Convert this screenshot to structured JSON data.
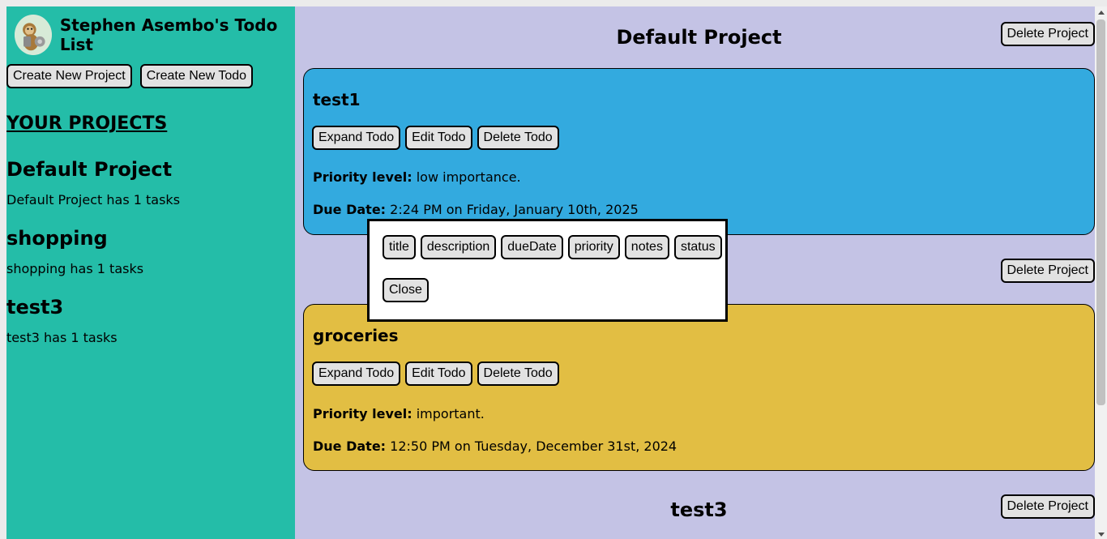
{
  "header": {
    "title": "Stephen Asembo's Todo List",
    "avatar_icon": "monkey-avatar-icon"
  },
  "sidebar": {
    "create_project_label": "Create New Project",
    "create_todo_label": "Create New Todo",
    "projects_heading": "YOUR PROJECTS",
    "projects": [
      {
        "name": "Default Project",
        "summary": "Default Project has 1 tasks"
      },
      {
        "name": "shopping",
        "summary": "shopping has 1 tasks"
      },
      {
        "name": "test3",
        "summary": "test3 has 1 tasks"
      }
    ]
  },
  "main": {
    "delete_project_label": "Delete Project",
    "todo_buttons": {
      "expand": "Expand Todo",
      "edit": "Edit Todo",
      "delete": "Delete Todo"
    },
    "priority_label": "Priority level:",
    "due_label": "Due Date:",
    "sections": [
      {
        "title": "Default Project",
        "todo": {
          "title": "test1",
          "priority": "low importance.",
          "due": "2:24 PM on Friday, January 10th, 2025",
          "color": "#33aadf"
        }
      },
      {
        "title": "",
        "todo": {
          "title": "groceries",
          "priority": "important.",
          "due": "12:50 PM on Tuesday, December 31st, 2024",
          "color": "#e2be43"
        }
      },
      {
        "title": "test3"
      }
    ]
  },
  "modal": {
    "fields": [
      "title",
      "description",
      "dueDate",
      "priority",
      "notes",
      "status"
    ],
    "close_label": "Close"
  },
  "colors": {
    "sidebar_bg": "#24bda8",
    "main_bg": "#c4c3e5",
    "button_bg": "#e2e2e2"
  }
}
